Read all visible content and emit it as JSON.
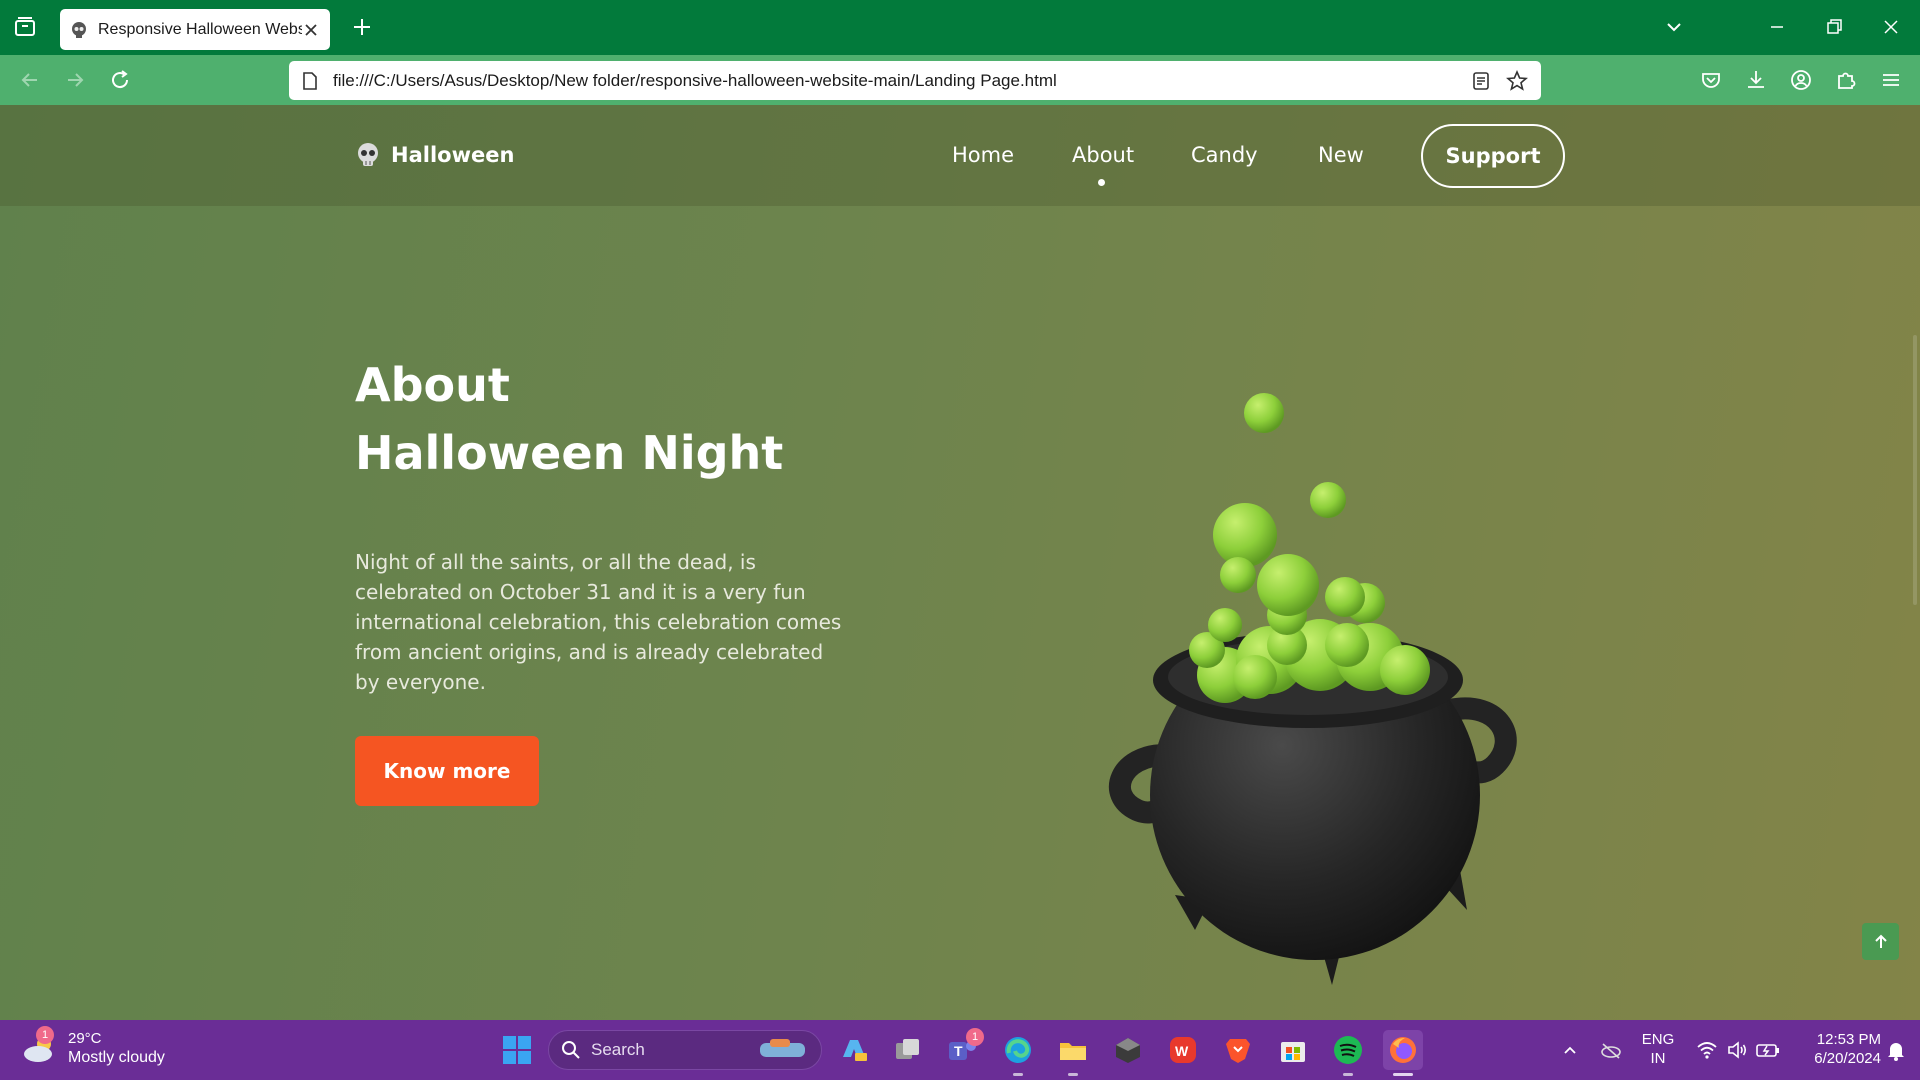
{
  "browser": {
    "tab_title": "Responsive Halloween Website",
    "url": "file:///C:/Users/Asus/Desktop/New folder/responsive-halloween-website-main/Landing Page.html"
  },
  "site": {
    "logo_text": "Halloween",
    "nav": [
      {
        "label": "Home"
      },
      {
        "label": "About"
      },
      {
        "label": "Candy"
      },
      {
        "label": "New"
      }
    ],
    "active_nav": "About",
    "support_label": "Support"
  },
  "hero": {
    "title": "About Halloween Night",
    "description": "Night of all the saints, or all the dead, is celebrated on October 31 and it is a very fun international celebration, this celebration comes from ancient origins, and is already celebrated by everyone.",
    "cta_label": "Know more"
  },
  "taskbar": {
    "weather_badge": "1",
    "temperature": "29°C",
    "condition": "Mostly cloudy",
    "search_placeholder": "Search",
    "teams_badge": "1",
    "language_line1": "ENG",
    "language_line2": "IN",
    "time": "12:53 PM",
    "date": "6/20/2024"
  },
  "colors": {
    "tabbar": "#027a3b",
    "navbar": "#4fb06e",
    "cta": "#f55522",
    "taskbar": "#6a2d96"
  }
}
